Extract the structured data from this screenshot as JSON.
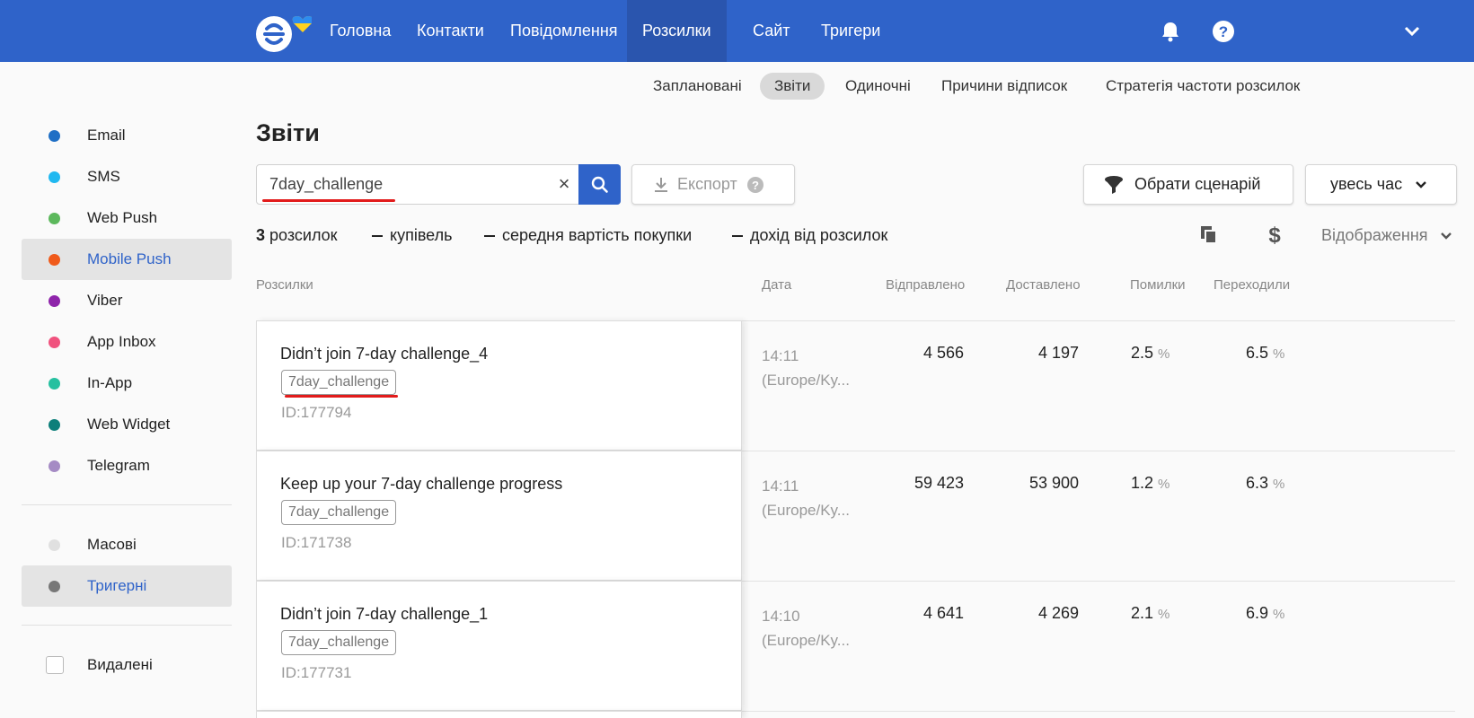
{
  "colors": {
    "brand": "#2f63c9",
    "brand_active": "#2a55ae",
    "highlight": "#e21b1b"
  },
  "nav": {
    "logo_icon": "esputnik-logo-icon",
    "items": [
      {
        "label": "Головна"
      },
      {
        "label": "Контакти"
      },
      {
        "label": "Повідомлення"
      },
      {
        "label": "Розсилки",
        "active": true
      },
      {
        "label": "Сайт"
      },
      {
        "label": "Тригери"
      }
    ],
    "icons": [
      "bell-icon",
      "help-icon",
      "chevron-down-icon"
    ]
  },
  "subnav": {
    "items": [
      {
        "label": "Заплановані"
      },
      {
        "label": "Звіти",
        "active": true
      },
      {
        "label": "Одиночні"
      },
      {
        "label": "Причини відписок"
      },
      {
        "label": "Стратегія частоти розсилок"
      }
    ]
  },
  "sidebar": {
    "channels": [
      {
        "label": "Email",
        "color": "#1f6fc5"
      },
      {
        "label": "SMS",
        "color": "#20b8f0"
      },
      {
        "label": "Web Push",
        "color": "#5cb85c"
      },
      {
        "label": "Mobile Push",
        "color": "#f05a1a",
        "active": true
      },
      {
        "label": "Viber",
        "color": "#8e24aa"
      },
      {
        "label": "App Inbox",
        "color": "#f0527e"
      },
      {
        "label": "In-App",
        "color": "#26c0a0"
      },
      {
        "label": "Web Widget",
        "color": "#0d7f7a"
      },
      {
        "label": "Telegram",
        "color": "#a58bc4"
      }
    ],
    "types": [
      {
        "label": "Масові",
        "color": "#e0e0e0"
      },
      {
        "label": "Тригерні",
        "color": "#777777",
        "active": true
      }
    ],
    "deleted_label": "Видалені"
  },
  "main": {
    "title": "Звіти",
    "search": {
      "value": "7day_challenge",
      "placeholder": ""
    },
    "export_label": "Експорт",
    "scenario_label": "Обрати сценарій",
    "period_label": "увесь час",
    "summary": {
      "count": "3",
      "count_label": "розсилок",
      "purchases_label": "купівель",
      "avg_label": "середня вартість покупки",
      "revenue_label": "дохід від розсилок"
    },
    "display_label": "Відображення",
    "columns": {
      "name": "Розсилки",
      "date": "Дата",
      "sent": "Відправлено",
      "delivered": "Доставлено",
      "errors": "Помилки",
      "clicks": "Переходили"
    },
    "pct_sign": "%",
    "rows": [
      {
        "title": "Didn’t join 7-day challenge_4",
        "tag": "7day_challenge",
        "id": "ID:177794",
        "time": "14:11",
        "tz": "(Europe/Ky...",
        "sent": "4 566",
        "delivered": "4 197",
        "errors": "2.5",
        "clicks": "6.5"
      },
      {
        "title": "Keep up your 7-day challenge progress",
        "tag": "7day_challenge",
        "id": "ID:171738",
        "time": "14:11",
        "tz": "(Europe/Ky...",
        "sent": "59 423",
        "delivered": "53 900",
        "errors": "1.2",
        "clicks": "6.3"
      },
      {
        "title": "Didn’t join 7-day challenge_1",
        "tag": "7day_challenge",
        "id": "ID:177731",
        "time": "14:10",
        "tz": "(Europe/Ky...",
        "sent": "4 641",
        "delivered": "4 269",
        "errors": "2.1",
        "clicks": "6.9"
      }
    ]
  }
}
